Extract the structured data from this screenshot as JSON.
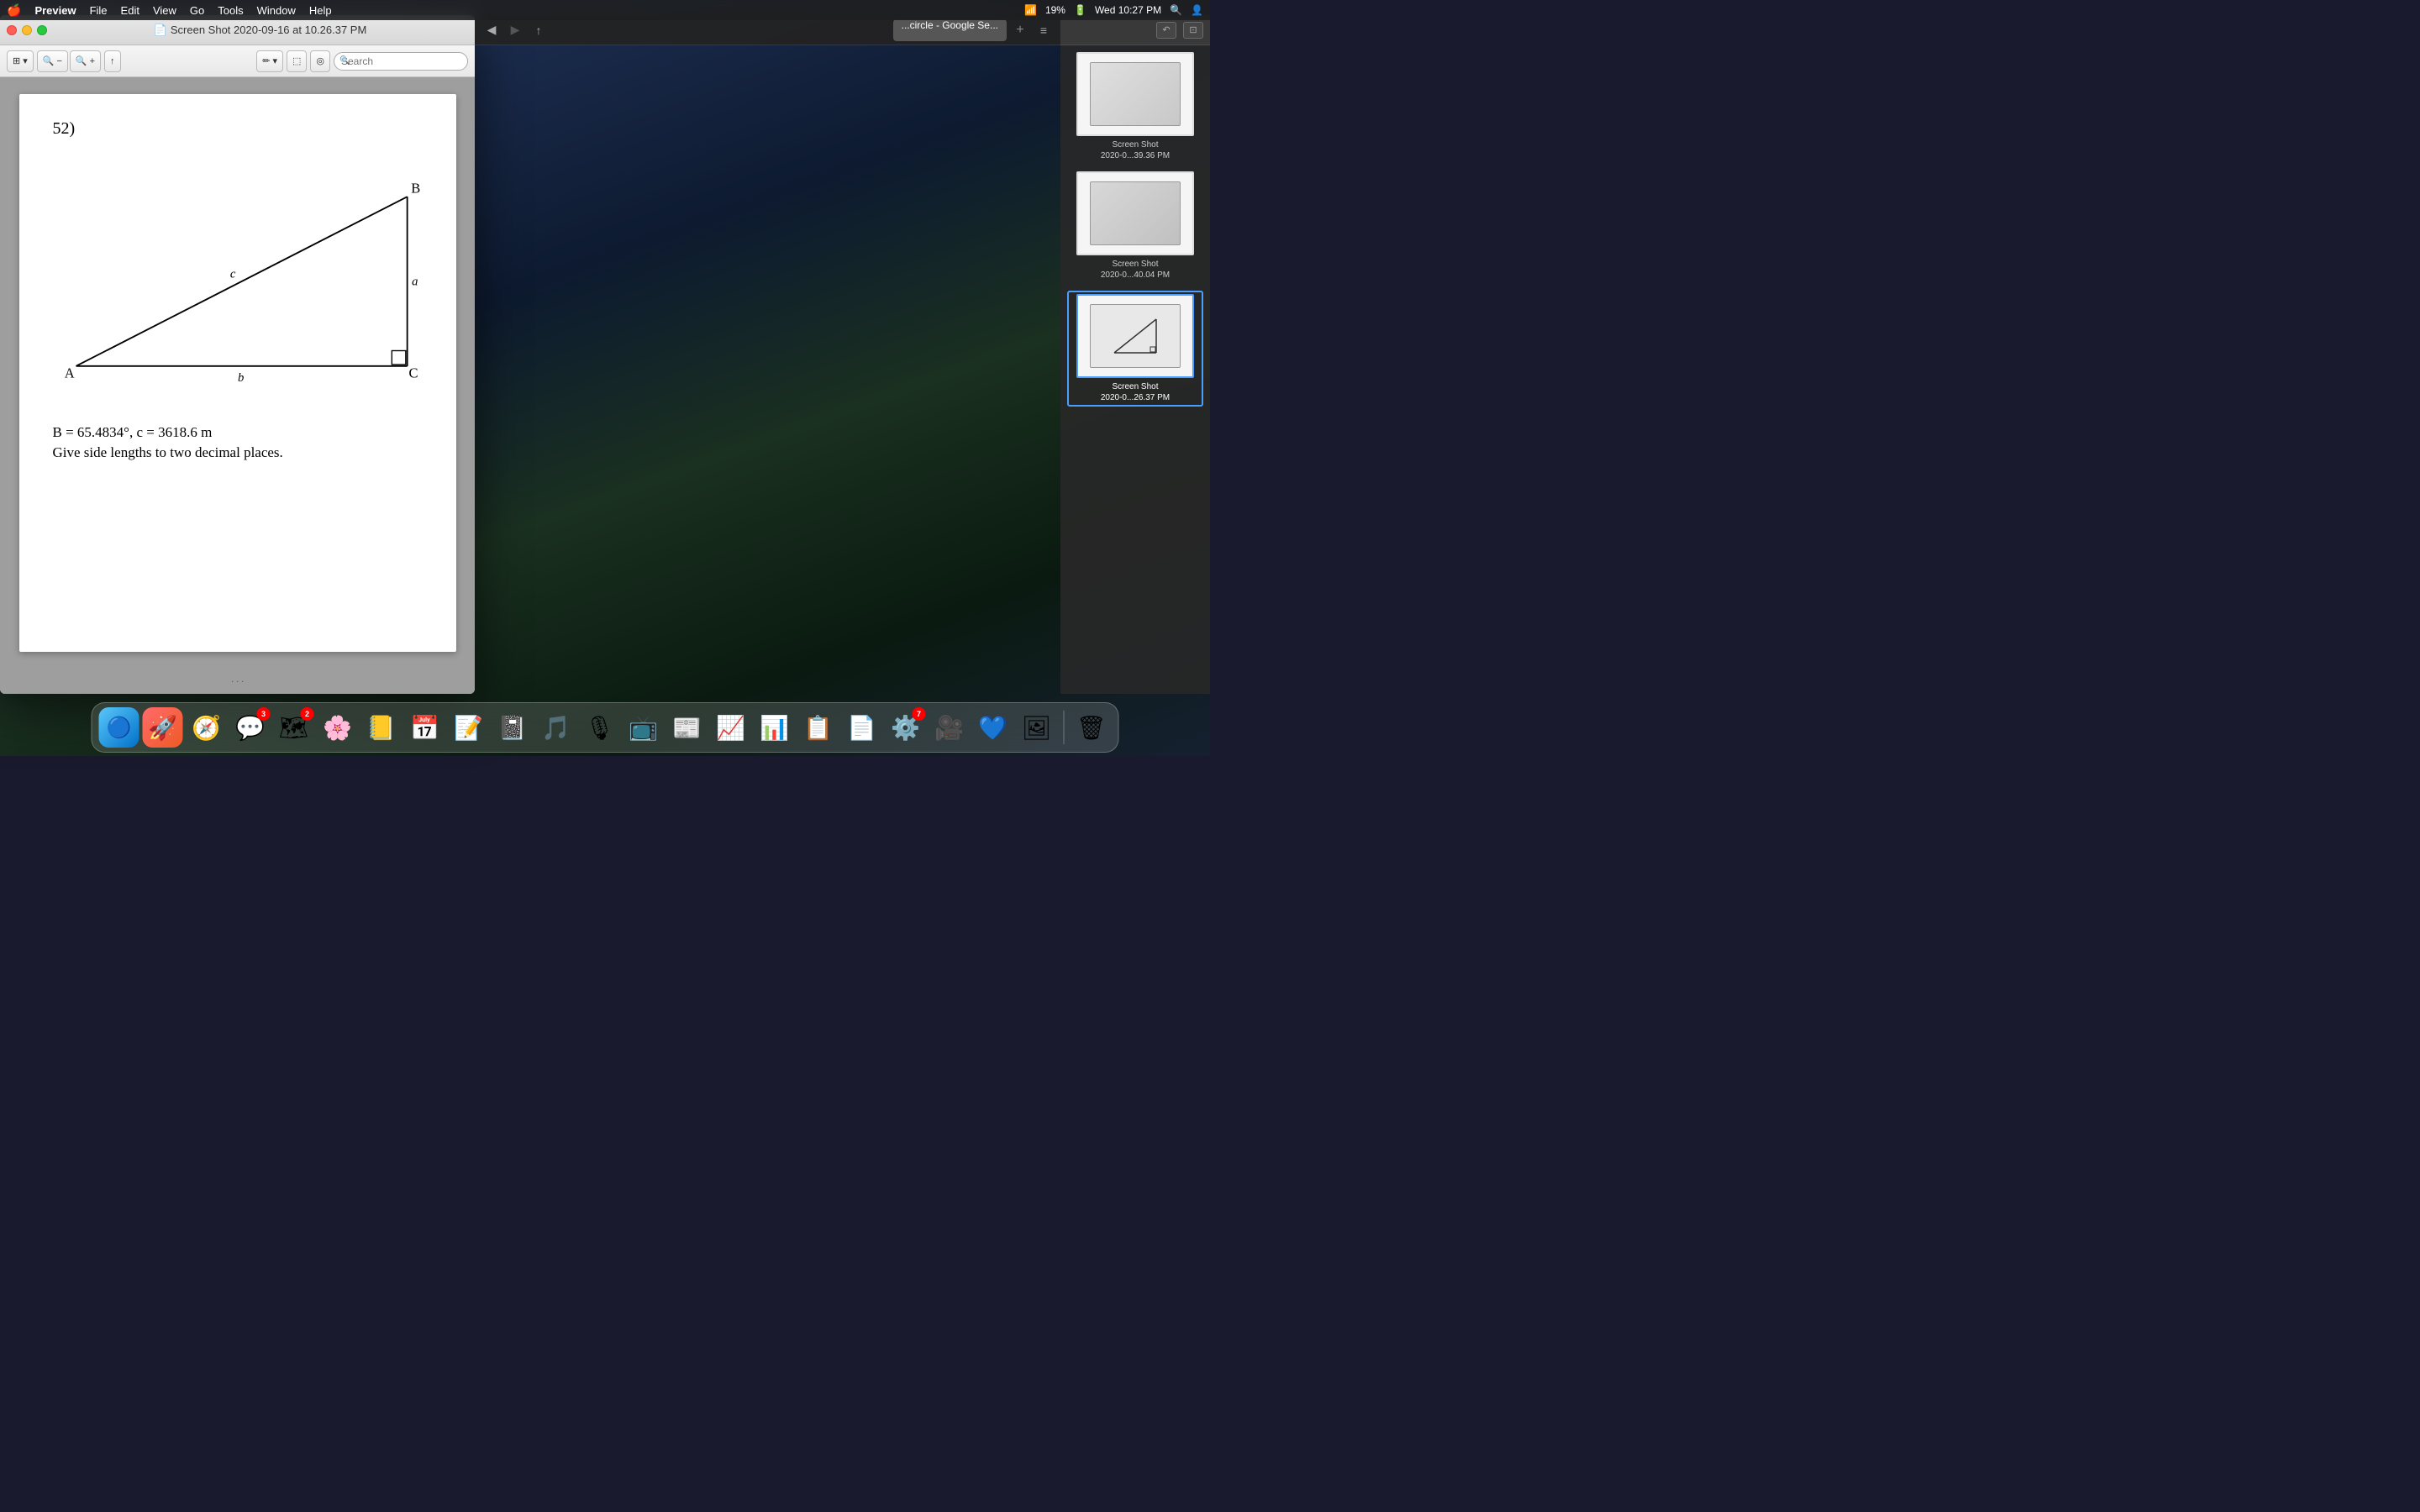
{
  "menubar": {
    "apple": "🍎",
    "app_name": "Preview",
    "menu_items": [
      "File",
      "Edit",
      "View",
      "Go",
      "Tools",
      "Window",
      "Help"
    ],
    "right_items": {
      "battery": "19%",
      "time": "Wed 10:27 PM"
    }
  },
  "window": {
    "title": "Screen Shot 2020-09-16 at 10.26.37 PM",
    "title_icon": "📄"
  },
  "toolbar": {
    "zoom_out_label": "−",
    "zoom_in_label": "+",
    "share_label": "↑",
    "markup_label": "✏",
    "search_placeholder": "Search"
  },
  "document": {
    "problem_number": "52)",
    "equation": "B = 65.4834°, c = 3618.6 m",
    "instruction": "Give side lengths to two decimal places.",
    "triangle": {
      "vertex_a": "A",
      "vertex_b": "B",
      "vertex_c": "C",
      "side_a": "a",
      "side_b": "b",
      "side_c": "c"
    }
  },
  "sidebar": {
    "thumbnails": [
      {
        "label": "Screen Shot\n2020-0...39.36 PM",
        "active": false
      },
      {
        "label": "Screen Shot\n2020-0...40.04 PM",
        "active": false
      },
      {
        "label": "Screen Shot\n2020-0...26.37 PM",
        "active": true
      }
    ]
  },
  "tab": {
    "label": "...circle - Google Se..."
  },
  "dock": {
    "icons": [
      {
        "name": "finder",
        "emoji": "🔵",
        "label": "Finder"
      },
      {
        "name": "launchpad",
        "emoji": "🚀",
        "label": "Launchpad"
      },
      {
        "name": "safari",
        "emoji": "🧭",
        "label": "Safari"
      },
      {
        "name": "messages",
        "emoji": "💬",
        "label": "Messages",
        "badge": "3"
      },
      {
        "name": "maps",
        "emoji": "🗺",
        "label": "Maps",
        "badge": "2"
      },
      {
        "name": "photos",
        "emoji": "🌸",
        "label": "Photos"
      },
      {
        "name": "contacts",
        "emoji": "📒",
        "label": "Contacts"
      },
      {
        "name": "calendar",
        "emoji": "📅",
        "label": "Calendar"
      },
      {
        "name": "reminders",
        "emoji": "📝",
        "label": "Reminders"
      },
      {
        "name": "notes",
        "emoji": "📓",
        "label": "Notes"
      },
      {
        "name": "music",
        "emoji": "🎵",
        "label": "Music"
      },
      {
        "name": "podcasts",
        "emoji": "🎙",
        "label": "Podcasts"
      },
      {
        "name": "appletv",
        "emoji": "📺",
        "label": "Apple TV"
      },
      {
        "name": "news",
        "emoji": "📰",
        "label": "News"
      },
      {
        "name": "stocks",
        "emoji": "📈",
        "label": "Stocks"
      },
      {
        "name": "keynote",
        "emoji": "📊",
        "label": "Keynote"
      },
      {
        "name": "numbers",
        "emoji": "📋",
        "label": "Numbers"
      },
      {
        "name": "pages",
        "emoji": "📄",
        "label": "Pages"
      },
      {
        "name": "systemprefs",
        "emoji": "⚙️",
        "label": "System Preferences",
        "badge": "7"
      },
      {
        "name": "zoom",
        "emoji": "🎥",
        "label": "Zoom"
      },
      {
        "name": "messages2",
        "emoji": "💙",
        "label": "Messages 2"
      },
      {
        "name": "preview",
        "emoji": "🖼",
        "label": "Preview"
      },
      {
        "name": "trash",
        "emoji": "🗑",
        "label": "Trash"
      }
    ]
  }
}
